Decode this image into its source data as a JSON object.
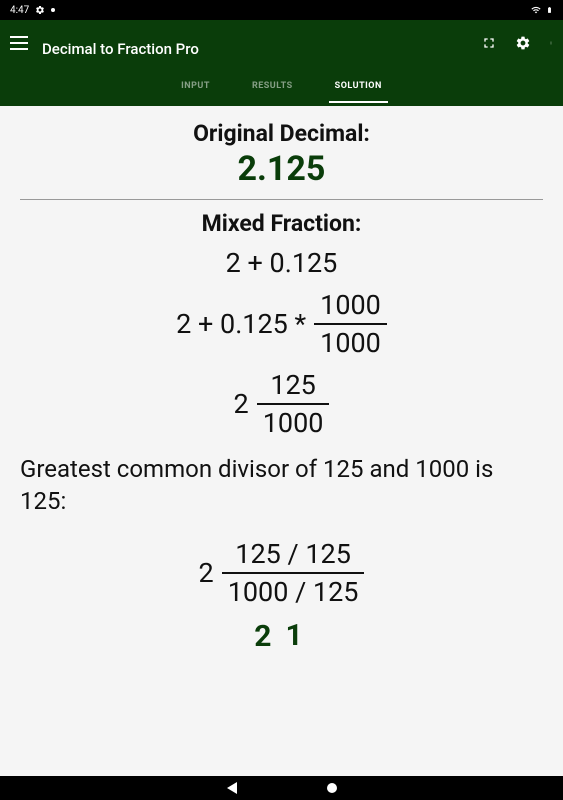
{
  "status": {
    "time": "4:47"
  },
  "header": {
    "title": "Decimal to Fraction Pro"
  },
  "tabs": {
    "input": "INPUT",
    "results": "RESULTS",
    "solution": "SOLUTION"
  },
  "solution": {
    "original_label": "Original Decimal:",
    "original_value": "2.125",
    "mixed_label": "Mixed Fraction:",
    "step1": "2 + 0.125",
    "step2_prefix": "2 + 0.125 *",
    "step2_num": "1000",
    "step2_den": "1000",
    "step3_whole": "2",
    "step3_num": "125",
    "step3_den": "1000",
    "gcd_text": "Greatest common divisor of 125 and 1000 is 125:",
    "step4_whole": "2",
    "step4_num": "125 / 125",
    "step4_den": "1000 / 125",
    "final_whole": "2",
    "final_num": "1"
  }
}
